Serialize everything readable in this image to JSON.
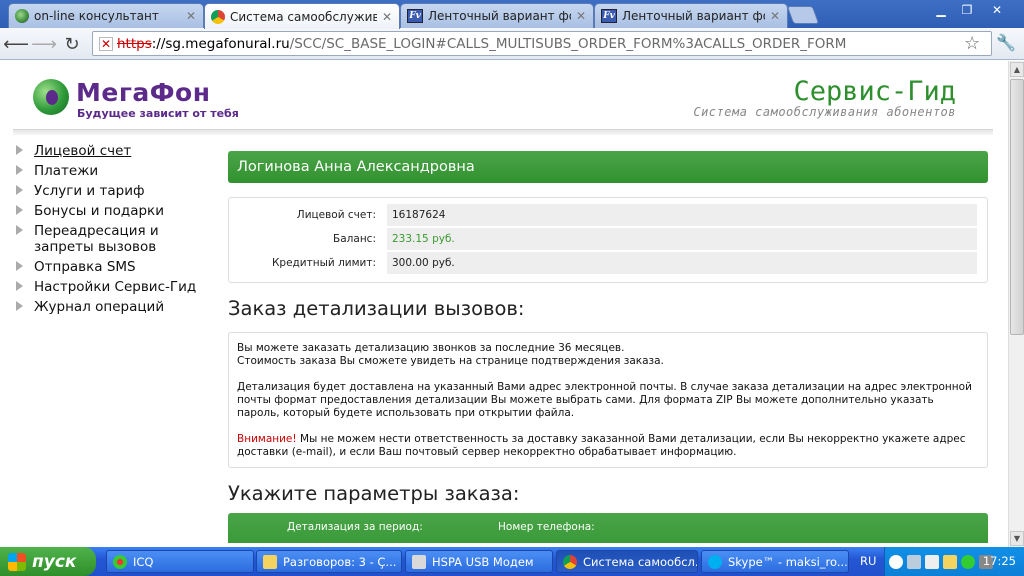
{
  "browser": {
    "tabs": [
      {
        "title": "on-line консультант",
        "favicon": "globe-icon"
      },
      {
        "title": "Система самообслуживания",
        "favicon": "chrome-icon"
      },
      {
        "title": "Ленточный вариант форума",
        "favicon": "forum-icon"
      },
      {
        "title": "Ленточный вариант форума",
        "favicon": "forum-icon"
      }
    ],
    "fv_label": "Fv",
    "url_scheme": "https",
    "url_host": "://sg.megafonural.ru",
    "url_path": "/SCC/SC_BASE_LOGIN#CALLS_MULTISUBS_ORDER_FORM%3ACALLS_ORDER_FORM"
  },
  "header": {
    "brand": "МегаФон",
    "slogan": "Будущее зависит от тебя",
    "service_title": "Сервис-Гид",
    "service_subtitle": "Система самообслуживания абонентов"
  },
  "sidebar": {
    "items": [
      {
        "label": "Лицевой счет"
      },
      {
        "label": "Платежи"
      },
      {
        "label": "Услуги и тариф"
      },
      {
        "label": "Бонусы и подарки"
      },
      {
        "label": "Переадресация и запреты вызовов"
      },
      {
        "label": "Отправка SMS"
      },
      {
        "label": "Настройки Сервис-Гид"
      },
      {
        "label": "Журнал операций"
      }
    ]
  },
  "account": {
    "owner": "Логинова Анна Александровна",
    "rows": [
      {
        "key": "Лицевой счет:",
        "value": "16187624"
      },
      {
        "key": "Баланс:",
        "value": "233.15 руб."
      },
      {
        "key": "Кредитный лимит:",
        "value": "300.00 руб."
      }
    ],
    "balance_color": "#3a9a2f"
  },
  "order": {
    "heading": "Заказ детализации вызовов:",
    "info_line1": "Вы можете заказать детализацию звонков за последние 36 месяцев.",
    "info_line2": "Стоимость заказа Вы сможете увидеть на странице подтверждения заказа.",
    "info_para2": "Детализация будет доставлена на указанный Вами адрес электронной почты. В случае заказа детализации на адрес электронной почты формат предоставления детализации Вы можете выбрать сами. Для формата ZIP Вы можете дополнительно указать пароль, который будете использовать при открытии файла.",
    "warning_label": "Внимание!",
    "warning_text": " Мы не можем нести ответственность за доставку заказанной Вами детализации, если Вы некорректно укажете адрес доставки (e-mail), и если Ваш почтовый сервер некорректно обрабатывает информацию.",
    "params_heading": "Укажите параметры заказа:",
    "col_period": "Детализация за период:",
    "col_phone": "Номер телефона:"
  },
  "taskbar": {
    "start": "пуск",
    "tasks": [
      {
        "label": "ICQ"
      },
      {
        "label": "Разговоров: 3 - Ç..."
      },
      {
        "label": "HSPA USB Модем"
      },
      {
        "label": "Система самообсл..."
      },
      {
        "label": "Skype™ - maksi_ro..."
      }
    ],
    "lang": "RU",
    "clock": "17:25"
  },
  "colors": {
    "accent_green": "#3a9a38",
    "brand_purple": "#5b2a8a",
    "warning_red": "#cc0000"
  }
}
